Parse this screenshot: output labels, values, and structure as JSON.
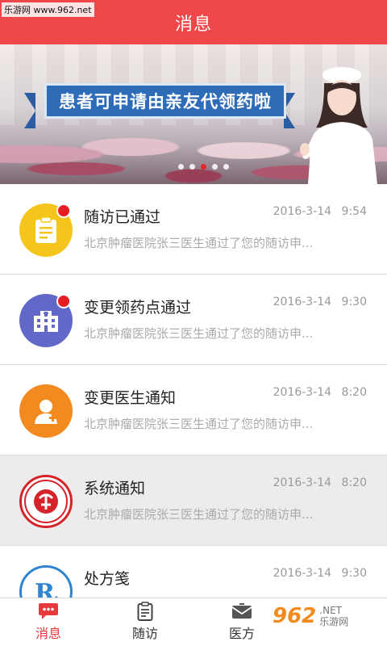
{
  "watermark_top": "乐游网 www.962.net",
  "header": {
    "title": "消息"
  },
  "banner": {
    "headline": "患者可申请由亲友代领药啦",
    "pager": {
      "count": 5,
      "active": 2
    }
  },
  "messages": [
    {
      "title": "随访已通过",
      "date": "2016-3-14",
      "time": "9:54",
      "preview": "北京肿瘤医院张三医生通过了您的随访申...",
      "icon": "clipboard-icon",
      "color": "#f6c51b",
      "unread": true
    },
    {
      "title": "变更领药点通过",
      "date": "2016-3-14",
      "time": "9:30",
      "preview": "北京肿瘤医院张三医生通过了您的随访申...",
      "icon": "hospital-icon",
      "color": "#6268c7",
      "unread": true
    },
    {
      "title": "变更医生通知",
      "date": "2016-3-14",
      "time": "8:20",
      "preview": "北京肿瘤医院张三医生通过了您的随访申...",
      "icon": "doctor-icon",
      "color": "#f38a1f",
      "unread": false
    },
    {
      "title": "系统通知",
      "date": "2016-3-14",
      "time": "8:20",
      "preview": "北京肿瘤医院张三医生通过了您的随访申...",
      "icon": "charity-logo-icon",
      "color": "#d4242a",
      "unread": false
    },
    {
      "title": "处方笺",
      "date": "2016-3-14",
      "time": "9:30",
      "preview": "",
      "icon": "rx-icon",
      "color": "#2f85cf",
      "unread": false
    }
  ],
  "tabs": [
    {
      "label": "消息",
      "icon": "chat-icon",
      "active": true
    },
    {
      "label": "随访",
      "icon": "clipboard-icon",
      "active": false
    },
    {
      "label": "医方",
      "icon": "envelope-icon",
      "active": false
    }
  ],
  "watermark_br": {
    "logo": "962",
    "suffix_top": ".NET",
    "suffix_bottom": "乐游网"
  }
}
